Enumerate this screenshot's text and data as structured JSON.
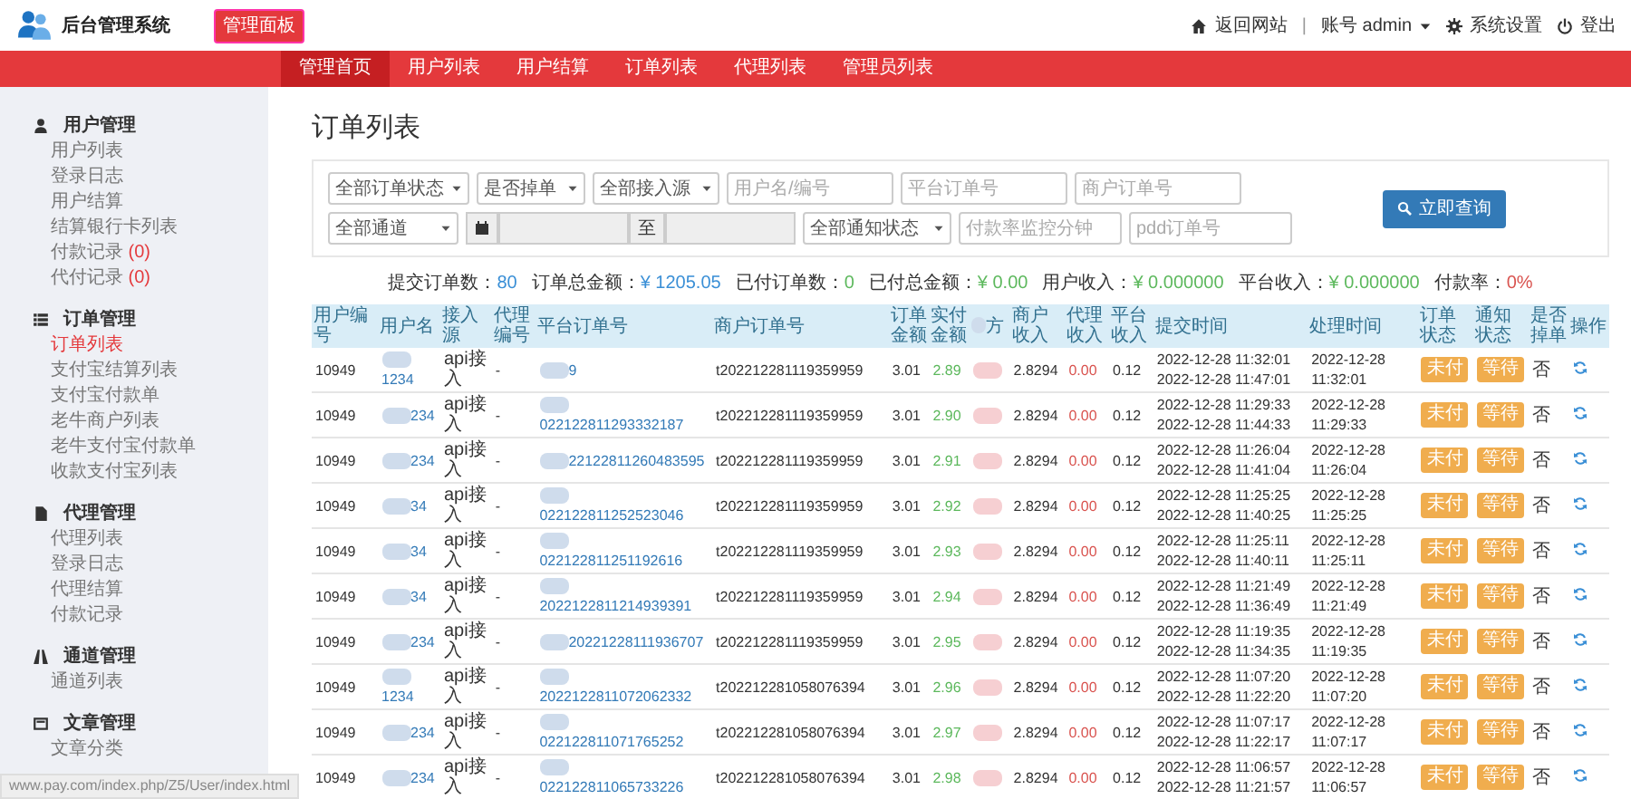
{
  "header": {
    "title": "后台管理系统",
    "badge": "管理面板",
    "separator": "|",
    "links": [
      {
        "kind": "home",
        "label": "返回网站"
      },
      {
        "kind": "account",
        "label": "账号 admin"
      },
      {
        "kind": "settings",
        "label": "系统设置"
      },
      {
        "kind": "logout",
        "label": "登出"
      }
    ]
  },
  "nav": [
    {
      "label": "管理首页",
      "selected": true
    },
    {
      "label": "用户列表",
      "selected": false
    },
    {
      "label": "用户结算",
      "selected": false
    },
    {
      "label": "订单列表",
      "selected": false
    },
    {
      "label": "代理列表",
      "selected": false
    },
    {
      "label": "管理员列表",
      "selected": false
    }
  ],
  "sidebar": [
    {
      "title": "用户管理",
      "items": [
        {
          "label": "用户列表",
          "selected": false
        },
        {
          "label": "登录日志",
          "selected": false
        },
        {
          "label": "用户结算",
          "selected": false
        },
        {
          "label": "结算银行卡列表",
          "selected": false
        },
        {
          "label": "付款记录",
          "count": "(0)",
          "selected": false
        },
        {
          "label": "代付记录",
          "count": "(0)",
          "selected": false
        }
      ]
    },
    {
      "title": "订单管理",
      "items": [
        {
          "label": "订单列表",
          "selected": true
        },
        {
          "label": "支付宝结算列表",
          "selected": false
        },
        {
          "label": "支付宝付款单",
          "selected": false
        },
        {
          "label": "老牛商户列表",
          "selected": false
        },
        {
          "label": "老牛支付宝付款单",
          "selected": false
        },
        {
          "label": "收款支付宝列表",
          "selected": false
        }
      ]
    },
    {
      "title": "代理管理",
      "items": [
        {
          "label": "代理列表",
          "selected": false
        },
        {
          "label": "登录日志",
          "selected": false
        },
        {
          "label": "代理结算",
          "selected": false
        },
        {
          "label": "付款记录",
          "selected": false
        }
      ]
    },
    {
      "title": "通道管理",
      "items": [
        {
          "label": "通道列表",
          "selected": false
        }
      ]
    },
    {
      "title": "文章管理",
      "items": [
        {
          "label": "文章分类",
          "selected": false
        }
      ]
    }
  ],
  "page_title": "订单列表",
  "filters": {
    "row1": [
      {
        "kind": "select",
        "value": "全部订单状态"
      },
      {
        "kind": "select",
        "value": "是否掉单"
      },
      {
        "kind": "select",
        "value": "全部接入源"
      },
      {
        "kind": "input",
        "placeholder": "用户名/编号"
      },
      {
        "kind": "input",
        "placeholder": "平台订单号"
      },
      {
        "kind": "input",
        "placeholder": "商户订单号"
      }
    ],
    "row2": [
      {
        "kind": "select",
        "value": "全部通道"
      },
      {
        "kind": "daterange",
        "separator": "至"
      },
      {
        "kind": "select",
        "value": "全部通知状态"
      },
      {
        "kind": "input",
        "placeholder": "付款率监控分钟"
      },
      {
        "kind": "input",
        "placeholder": "pdd订单号"
      }
    ],
    "button": "立即查询"
  },
  "stats": [
    {
      "label": "提交订单数：",
      "value": "80",
      "color": "#3a8fd6"
    },
    {
      "label": "订单总金额：",
      "value": "¥ 1205.05",
      "color": "#3a8fd6"
    },
    {
      "label": "已付订单数：",
      "value": "0",
      "color": "#5cb85c"
    },
    {
      "label": "已付总金额：",
      "value": "¥ 0.00",
      "color": "#5cb85c"
    },
    {
      "label": "用户收入：",
      "value": "¥ 0.000000",
      "color": "#5cb85c"
    },
    {
      "label": "平台收入：",
      "value": "¥ 0.000000",
      "color": "#5cb85c"
    },
    {
      "label": "付款率：",
      "value": "0%",
      "color": "#d9534f"
    }
  ],
  "table": {
    "columns": [
      {
        "label": "用户编号"
      },
      {
        "label": "用户名"
      },
      {
        "label": "接入源"
      },
      {
        "label": "代理编号"
      },
      {
        "label": "平台订单号"
      },
      {
        "label": "商户订单号"
      },
      {
        "label": "订单金额"
      },
      {
        "label": "实付金额"
      },
      {
        "label": "方",
        "blurred": true
      },
      {
        "label": "商户收入"
      },
      {
        "label": "代理收入"
      },
      {
        "label": "平台收入"
      },
      {
        "label": "提交时间"
      },
      {
        "label": "处理时间"
      },
      {
        "label": "订单状态"
      },
      {
        "label": "通知状态"
      },
      {
        "label": "是否掉单"
      },
      {
        "label": "操作"
      }
    ],
    "rows": [
      {
        "user_id": "10949",
        "username": "1234",
        "source": "api接入",
        "agent_id": "-",
        "platform_order": "9",
        "merchant_order": "t202212281119359959",
        "amount": "3.01",
        "paid": "2.89",
        "merchant_income": "2.8294",
        "agent_income": "0.00",
        "platform_income": "0.12",
        "submit_time": "2022-12-28 11:32:01",
        "expire_time": "2022-12-28 11:47:01",
        "process_time": "2022-12-28 11:32:01",
        "order_status": "未付",
        "notify_status": "等待",
        "dropped": "否",
        "blurred": true
      },
      {
        "user_id": "10949",
        "username": "234",
        "source": "api接入",
        "agent_id": "-",
        "platform_order": "022122811293332187",
        "merchant_order": "t202212281119359959",
        "amount": "3.01",
        "paid": "2.90",
        "merchant_income": "2.8294",
        "agent_income": "0.00",
        "platform_income": "0.12",
        "submit_time": "2022-12-28 11:29:33",
        "expire_time": "2022-12-28 11:44:33",
        "process_time": "2022-12-28 11:29:33",
        "order_status": "未付",
        "notify_status": "等待",
        "dropped": "否",
        "blurred": true
      },
      {
        "user_id": "10949",
        "username": "234",
        "source": "api接入",
        "agent_id": "-",
        "platform_order": "22122811260483595",
        "merchant_order": "t202212281119359959",
        "amount": "3.01",
        "paid": "2.91",
        "merchant_income": "2.8294",
        "agent_income": "0.00",
        "platform_income": "0.12",
        "submit_time": "2022-12-28 11:26:04",
        "expire_time": "2022-12-28 11:41:04",
        "process_time": "2022-12-28 11:26:04",
        "order_status": "未付",
        "notify_status": "等待",
        "dropped": "否",
        "blurred": true
      },
      {
        "user_id": "10949",
        "username": "34",
        "source": "api接入",
        "agent_id": "-",
        "platform_order": "022122811252523046",
        "merchant_order": "t202212281119359959",
        "amount": "3.01",
        "paid": "2.92",
        "merchant_income": "2.8294",
        "agent_income": "0.00",
        "platform_income": "0.12",
        "submit_time": "2022-12-28 11:25:25",
        "expire_time": "2022-12-28 11:40:25",
        "process_time": "2022-12-28 11:25:25",
        "order_status": "未付",
        "notify_status": "等待",
        "dropped": "否",
        "blurred": true
      },
      {
        "user_id": "10949",
        "username": "34",
        "source": "api接入",
        "agent_id": "-",
        "platform_order": "022122811251192616",
        "merchant_order": "t202212281119359959",
        "amount": "3.01",
        "paid": "2.93",
        "merchant_income": "2.8294",
        "agent_income": "0.00",
        "platform_income": "0.12",
        "submit_time": "2022-12-28 11:25:11",
        "expire_time": "2022-12-28 11:40:11",
        "process_time": "2022-12-28 11:25:11",
        "order_status": "未付",
        "notify_status": "等待",
        "dropped": "否",
        "blurred": true
      },
      {
        "user_id": "10949",
        "username": "34",
        "source": "api接入",
        "agent_id": "-",
        "platform_order": "2022122811214939391",
        "merchant_order": "t202212281119359959",
        "amount": "3.01",
        "paid": "2.94",
        "merchant_income": "2.8294",
        "agent_income": "0.00",
        "platform_income": "0.12",
        "submit_time": "2022-12-28 11:21:49",
        "expire_time": "2022-12-28 11:36:49",
        "process_time": "2022-12-28 11:21:49",
        "order_status": "未付",
        "notify_status": "等待",
        "dropped": "否",
        "blurred": true
      },
      {
        "user_id": "10949",
        "username": "234",
        "source": "api接入",
        "agent_id": "-",
        "platform_order": "20221228111936707",
        "merchant_order": "t202212281119359959",
        "amount": "3.01",
        "paid": "2.95",
        "merchant_income": "2.8294",
        "agent_income": "0.00",
        "platform_income": "0.12",
        "submit_time": "2022-12-28 11:19:35",
        "expire_time": "2022-12-28 11:34:35",
        "process_time": "2022-12-28 11:19:35",
        "order_status": "未付",
        "notify_status": "等待",
        "dropped": "否",
        "blurred": true
      },
      {
        "user_id": "10949",
        "username": "1234",
        "source": "api接入",
        "agent_id": "-",
        "platform_order": "2022122811072062332",
        "merchant_order": "t202212281058076394",
        "amount": "3.01",
        "paid": "2.96",
        "merchant_income": "2.8294",
        "agent_income": "0.00",
        "platform_income": "0.12",
        "submit_time": "2022-12-28 11:07:20",
        "expire_time": "2022-12-28 11:22:20",
        "process_time": "2022-12-28 11:07:20",
        "order_status": "未付",
        "notify_status": "等待",
        "dropped": "否",
        "blurred": true
      },
      {
        "user_id": "10949",
        "username": "234",
        "source": "api接入",
        "agent_id": "-",
        "platform_order": "022122811071765252",
        "merchant_order": "t202212281058076394",
        "amount": "3.01",
        "paid": "2.97",
        "merchant_income": "2.8294",
        "agent_income": "0.00",
        "platform_income": "0.12",
        "submit_time": "2022-12-28 11:07:17",
        "expire_time": "2022-12-28 11:22:17",
        "process_time": "2022-12-28 11:07:17",
        "order_status": "未付",
        "notify_status": "等待",
        "dropped": "否",
        "blurred": true
      },
      {
        "user_id": "10949",
        "username": "234",
        "source": "api接入",
        "agent_id": "-",
        "platform_order": "022122811065733226",
        "merchant_order": "t202212281058076394",
        "amount": "3.01",
        "paid": "2.98",
        "merchant_income": "2.8294",
        "agent_income": "0.00",
        "platform_income": "0.12",
        "submit_time": "2022-12-28 11:06:57",
        "expire_time": "2022-12-28 11:21:57",
        "process_time": "2022-12-28 11:06:57",
        "order_status": "未付",
        "notify_status": "等待",
        "dropped": "否",
        "blurred": true
      }
    ]
  },
  "status_bar": {
    "url": "www.pay.com/index.php/Z5/User/index.html"
  }
}
